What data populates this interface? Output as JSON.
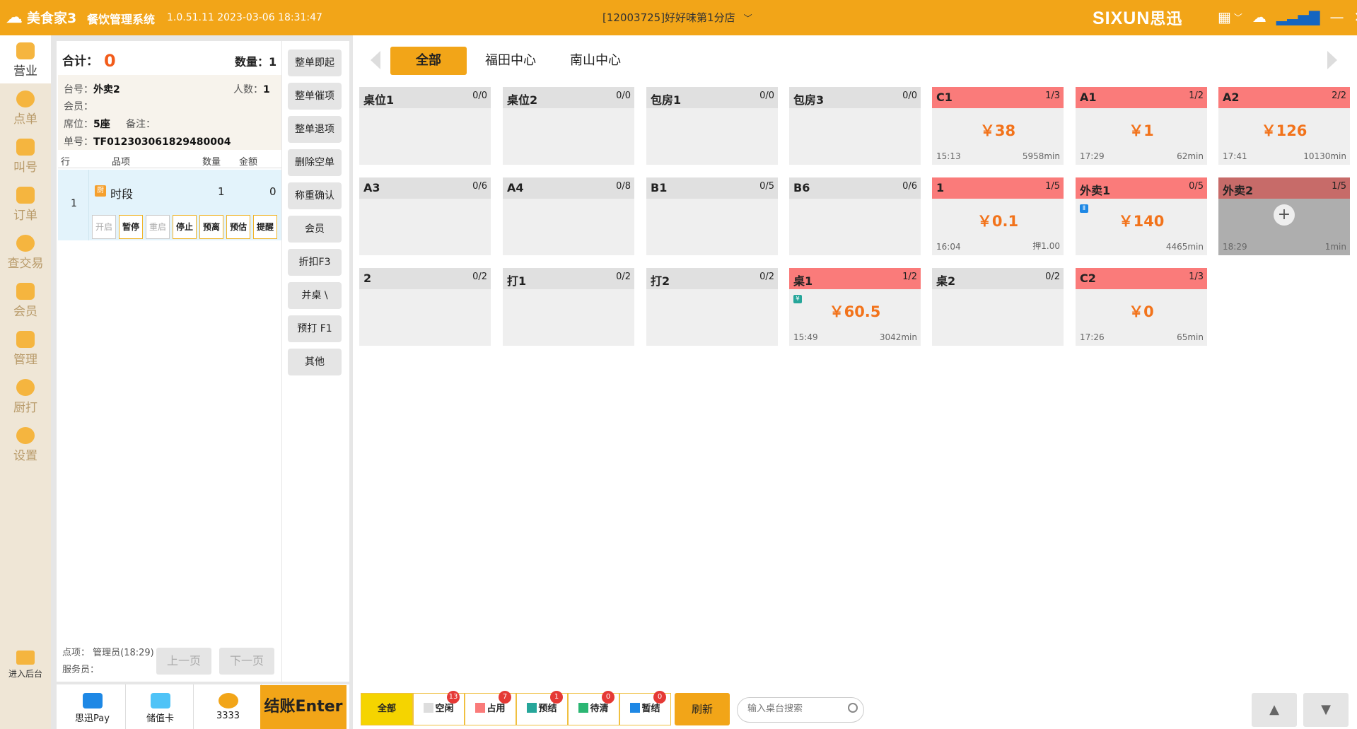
{
  "titlebar": {
    "brand": "美食家3",
    "app": "餐饮管理系统",
    "version": "1.0.51.11 2023-03-06 18:31:47",
    "store": "[12003725]好好味第1分店",
    "logo_text": "SIXUN",
    "logo_cn": "思迅"
  },
  "sidebar": {
    "items": [
      {
        "label": "营业"
      },
      {
        "label": "点单"
      },
      {
        "label": "叫号"
      },
      {
        "label": "订单"
      },
      {
        "label": "查交易"
      },
      {
        "label": "会员"
      },
      {
        "label": "管理"
      },
      {
        "label": "厨打"
      },
      {
        "label": "设置"
      }
    ],
    "bottom": "进入后台"
  },
  "order": {
    "total_label": "合计：",
    "total_value": "0",
    "qty_label": "数量：",
    "qty_value": "1",
    "table_label": "台号：",
    "table_value": "外卖2",
    "people_label": "人数：",
    "people_value": "1",
    "member_label": "会员：",
    "seat_label": "席位：",
    "seat_value": "5座",
    "remark_label": "备注：",
    "bill_label": "单号：",
    "bill_value": "TF012303061829480004",
    "cols": {
      "row": "行",
      "item": "品项",
      "qty": "数量",
      "amount": "金额"
    },
    "rows": [
      {
        "num": "1",
        "name": "时段",
        "qty": "1",
        "amount": "0"
      }
    ],
    "row_buttons": [
      "开启",
      "暂停",
      "重启",
      "停止",
      "预离",
      "预估",
      "提醒"
    ],
    "operator": "点项：  管理员(18:29)",
    "waiter": "服务员：",
    "prev": "上一页",
    "next": "下一页"
  },
  "actions": [
    "整单即起",
    "整单催项",
    "整单退项",
    "删除空单",
    "称重确认",
    "会员",
    "折扣F3",
    "并桌 \\",
    "预打 F1",
    "其他"
  ],
  "pay": [
    {
      "label": "思迅Pay"
    },
    {
      "label": "储值卡"
    },
    {
      "label": "3333"
    }
  ],
  "checkout": "结账Enter",
  "areas": [
    "全部",
    "福田中心",
    "南山中心"
  ],
  "tables": [
    {
      "name": "桌位1",
      "count": "0/0"
    },
    {
      "name": "桌位2",
      "count": "0/0"
    },
    {
      "name": "包房1",
      "count": "0/0"
    },
    {
      "name": "包房3",
      "count": "0/0"
    },
    {
      "name": "C1",
      "count": "1/3",
      "amount": "￥38",
      "time": "15:13",
      "dur": "5958min"
    },
    {
      "name": "A1",
      "count": "1/2",
      "amount": "￥1",
      "time": "17:29",
      "dur": "62min"
    },
    {
      "name": "A2",
      "count": "2/2",
      "amount": "￥126",
      "time": "17:41",
      "dur": "10130min"
    },
    {
      "name": "A3",
      "count": "0/6"
    },
    {
      "name": "A4",
      "count": "0/8"
    },
    {
      "name": "B1",
      "count": "0/5"
    },
    {
      "name": "B6",
      "count": "0/6"
    },
    {
      "name": "1",
      "count": "1/5",
      "amount": "￥0.1",
      "time": "16:04",
      "dur": "押1.00"
    },
    {
      "name": "外卖1",
      "count": "0/5",
      "amount": "￥140",
      "time": "",
      "dur": "4465min"
    },
    {
      "name": "外卖2",
      "count": "1/5",
      "time": "18:29",
      "dur": "1min"
    },
    {
      "name": "2",
      "count": "0/2"
    },
    {
      "name": "打1",
      "count": "0/2"
    },
    {
      "name": "打2",
      "count": "0/2"
    },
    {
      "name": "桌1",
      "count": "1/2",
      "amount": "￥60.5",
      "time": "15:49",
      "dur": "3042min"
    },
    {
      "name": "桌2",
      "count": "0/2"
    },
    {
      "name": "C2",
      "count": "1/3",
      "amount": "￥0",
      "time": "17:26",
      "dur": "65min"
    }
  ],
  "filters": [
    {
      "label": "全部"
    },
    {
      "label": "空闲",
      "count": "13"
    },
    {
      "label": "占用",
      "count": "7"
    },
    {
      "label": "预结",
      "count": "1"
    },
    {
      "label": "待清",
      "count": "0"
    },
    {
      "label": "暂结",
      "count": "0"
    }
  ],
  "refresh": "刷新",
  "search": {
    "placeholder": "输入桌台搜索"
  },
  "colors": {
    "accent": "#F2A518",
    "busy": "#FA7B7A",
    "amount": "#F2731B"
  }
}
